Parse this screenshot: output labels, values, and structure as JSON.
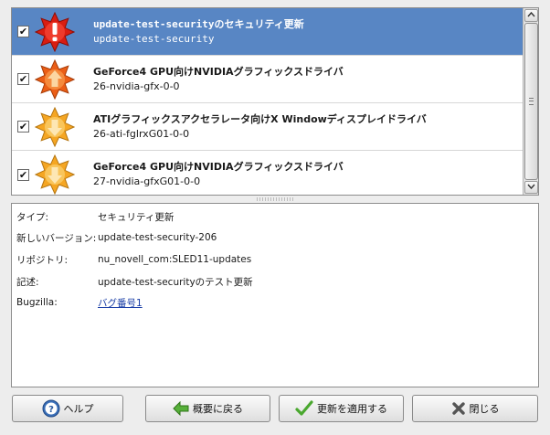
{
  "updates": [
    {
      "title": "update-test-securityのセキュリティ更新",
      "subtitle": "update-test-security",
      "checked": true,
      "selected": true,
      "icon": "security-alert-icon"
    },
    {
      "title": "GeForce4 GPU向けNVIDIAグラフィックスドライバ",
      "subtitle": "26-nvidia-gfx-0-0",
      "checked": true,
      "selected": false,
      "icon": "recommended-update-icon"
    },
    {
      "title": "ATIグラフィックスアクセラレータ向けX Windowディスプレイドライバ",
      "subtitle": "26-ati-fglrxG01-0-0",
      "checked": true,
      "selected": false,
      "icon": "optional-update-icon"
    },
    {
      "title": "GeForce4 GPU向けNVIDIAグラフィックスドライバ",
      "subtitle": "27-nvidia-gfxG01-0-0",
      "checked": true,
      "selected": false,
      "icon": "optional-update-icon"
    }
  ],
  "checkmark": "✔",
  "details": {
    "type_label": "タイプ:",
    "type_value": "セキュリティ更新",
    "version_label": "新しいバージョン:",
    "version_value": "update-test-security-206",
    "repo_label": "リポジトリ:",
    "repo_value": "nu_novell_com:SLED11-updates",
    "desc_label": "記述:",
    "desc_value": "update-test-securityのテスト更新",
    "bugzilla_label": "Bugzilla:",
    "bugzilla_link": "バグ番号1"
  },
  "buttons": {
    "help": "ヘルプ",
    "back": "概要に戻る",
    "apply": "更新を適用する",
    "close": "閉じる"
  },
  "colors": {
    "selection": "#5886c4",
    "security": "#e0261a",
    "recommended": "#ef6a1c",
    "optional": "#f7ad2e"
  }
}
